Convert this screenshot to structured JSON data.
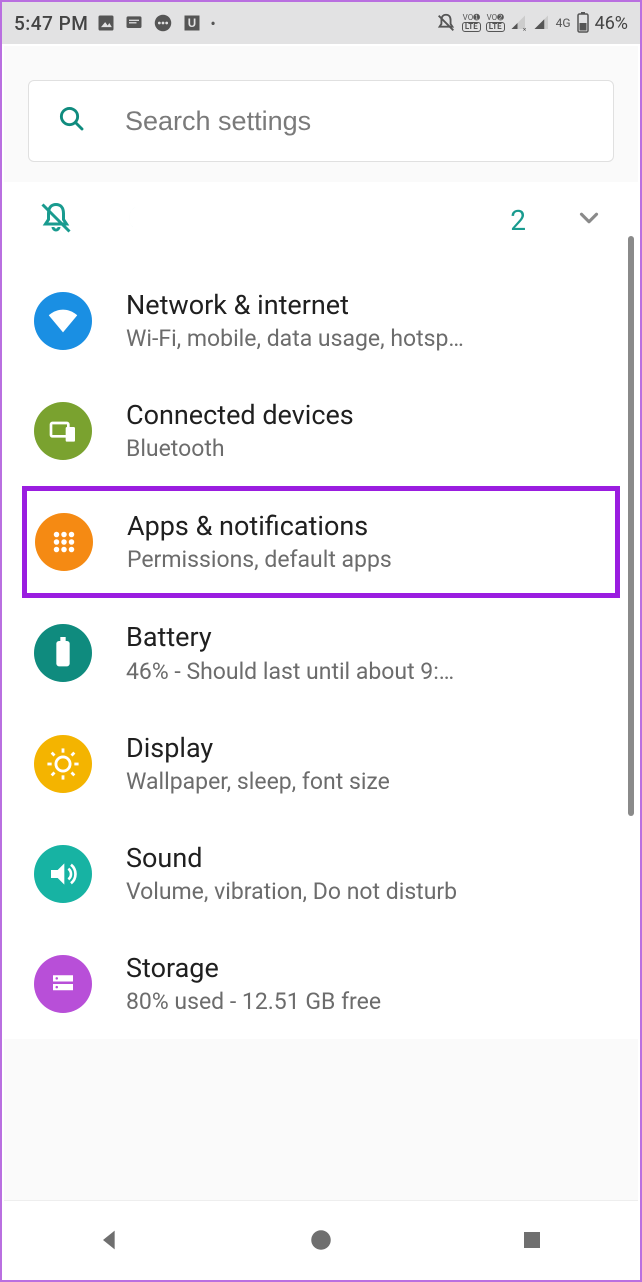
{
  "status": {
    "time": "5:47 PM",
    "battery_pct": "46%",
    "network": "4G"
  },
  "search": {
    "placeholder": "Search settings"
  },
  "quick": {
    "count": "2"
  },
  "rows": [
    {
      "id": "network",
      "title": "Network & internet",
      "sub": "Wi-Fi, mobile, data usage, hotsp…",
      "color": "#1a8fe3"
    },
    {
      "id": "connected",
      "title": "Connected devices",
      "sub": "Bluetooth",
      "color": "#7aa22f"
    },
    {
      "id": "apps",
      "title": "Apps & notifications",
      "sub": "Permissions, default apps",
      "color": "#f58a13",
      "highlight": true
    },
    {
      "id": "battery",
      "title": "Battery",
      "sub": "46% - Should last until about 9:…",
      "color": "#0f8b7e"
    },
    {
      "id": "display",
      "title": "Display",
      "sub": "Wallpaper, sleep, font size",
      "color": "#f4b400"
    },
    {
      "id": "sound",
      "title": "Sound",
      "sub": "Volume, vibration, Do not disturb",
      "color": "#17b3a3"
    },
    {
      "id": "storage",
      "title": "Storage",
      "sub": "80% used - 12.51 GB free",
      "color": "#b84fd8"
    }
  ]
}
